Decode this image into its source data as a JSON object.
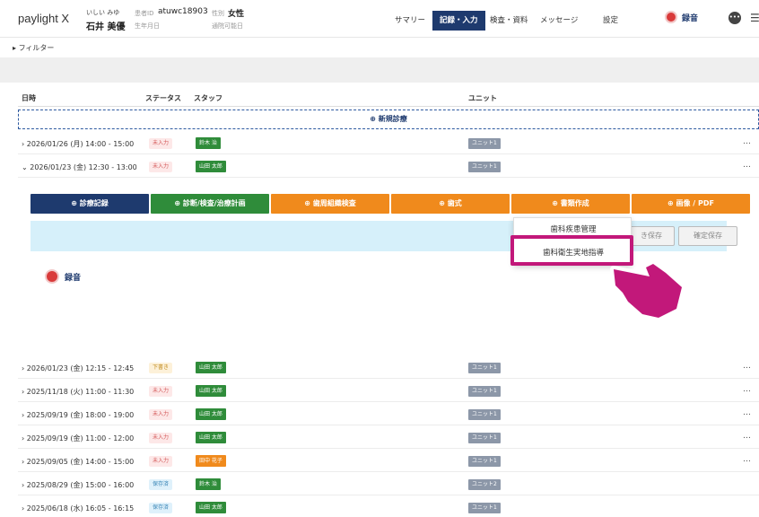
{
  "header": {
    "logo": "paylight X",
    "patient_kana": "いしい みゆ",
    "patient_name": "石井 美優",
    "id_label": "患者ID",
    "id_value": "atuwc18903",
    "birth_label": "生年月日",
    "sex_label": "性別",
    "sex_value": "女性",
    "visit_label": "通院可能日",
    "nav": [
      "サマリー",
      "記録・入力",
      "検査・資料",
      "メッセージ",
      "設定"
    ],
    "active_nav": "記録・入力",
    "record_label": "録音",
    "chat_icon": "chat-icon",
    "menu_icon": "menu-icon"
  },
  "filter": {
    "label": "フィルター"
  },
  "table": {
    "col_date": "日時",
    "col_status": "ステータス",
    "col_staff": "スタッフ",
    "col_unit": "ユニット",
    "new_visit": "新規診療",
    "rows": [
      {
        "date": "2026/01/26 (月) 14:00 - 15:00",
        "status": "未入力",
        "staff": "鈴木 治",
        "unit": "ユニット1",
        "more": "…"
      },
      {
        "date": "2026/01/23 (金) 12:30 - 13:00",
        "status": "未入力",
        "staff": "山田 太郎",
        "unit": "ユニット1",
        "more": "…"
      },
      {
        "date": "2026/01/23 (金) 12:15 - 12:45",
        "status": "下書き",
        "staff": "山田 太郎",
        "unit": "ユニット1",
        "more": "…"
      },
      {
        "date": "2025/11/18 (火) 11:00 - 11:30",
        "status": "未入力",
        "staff": "山田 太郎",
        "unit": "ユニット1",
        "more": "…"
      },
      {
        "date": "2025/09/19 (金) 18:00 - 19:00",
        "status": "未入力",
        "staff": "山田 太郎",
        "unit": "ユニット1",
        "more": "…"
      },
      {
        "date": "2025/09/19 (金) 11:00 - 12:00",
        "status": "未入力",
        "staff": "山田 太郎",
        "unit": "ユニット1",
        "more": "…"
      },
      {
        "date": "2025/09/05 (金) 14:00 - 15:00",
        "status": "未入力",
        "staff": "田中 花子",
        "unit": "ユニット1",
        "more": "…"
      },
      {
        "date": "2025/08/29 (金) 15:00 - 16:00",
        "status": "保存済",
        "staff": "鈴木 治",
        "unit": "ユニット2",
        "more": ""
      },
      {
        "date": "2025/06/18 (水) 16:05 - 16:15",
        "status": "保存済",
        "staff": "山田 太郎",
        "unit": "ユニット1",
        "more": ""
      }
    ]
  },
  "actions": {
    "buttons": [
      "診療記録",
      "診断/検査/治療計画",
      "歯周組織検査",
      "歯式",
      "書類作成",
      "画像 / PDF"
    ],
    "dropdown_items": [
      "歯科疾患管理",
      "歯科衛生実地指導"
    ],
    "draft_save": "き保存",
    "confirm_save": "確定保存",
    "record_label": "録音"
  },
  "colors": {
    "navy": "#1e3a6e",
    "green": "#2f8c3a",
    "orange": "#f08a1c",
    "highlight": "#c2187a",
    "subbar": "#d6f0fa"
  }
}
